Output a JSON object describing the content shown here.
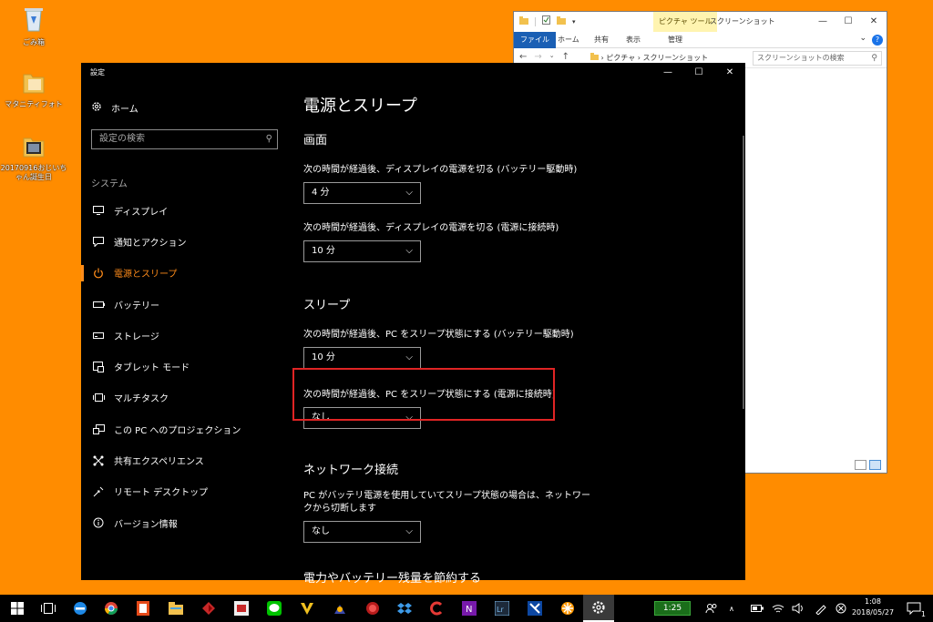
{
  "desktop": {
    "icons": [
      {
        "label": "ごみ箱"
      },
      {
        "label": "マタニティフォト"
      },
      {
        "label": "20170916おじいちゃん誕生日"
      }
    ]
  },
  "explorer": {
    "context_tab": "ピクチャ ツール",
    "title": "スクリーンショット",
    "tabs": [
      "ファイル",
      "ホーム",
      "共有",
      "表示",
      "管理"
    ],
    "path": "› ピクチャ › スクリーンショット",
    "search_placeholder": "スクリーンショットの検索",
    "help": "?"
  },
  "settings": {
    "window_title": "設定",
    "home_label": "ホーム",
    "search_placeholder": "設定の検索",
    "section_label": "システム",
    "nav_items": [
      {
        "label": "ディスプレイ",
        "icon": "display-icon"
      },
      {
        "label": "通知とアクション",
        "icon": "notification-icon"
      },
      {
        "label": "電源とスリープ",
        "icon": "power-icon",
        "active": true
      },
      {
        "label": "バッテリー",
        "icon": "battery-icon"
      },
      {
        "label": "ストレージ",
        "icon": "storage-icon"
      },
      {
        "label": "タブレット モード",
        "icon": "tablet-icon"
      },
      {
        "label": "マルチタスク",
        "icon": "multitask-icon"
      },
      {
        "label": "この PC へのプロジェクション",
        "icon": "projection-icon"
      },
      {
        "label": "共有エクスペリエンス",
        "icon": "shared-icon"
      },
      {
        "label": "リモート デスクトップ",
        "icon": "remote-icon"
      },
      {
        "label": "バージョン情報",
        "icon": "info-icon"
      }
    ],
    "page_title": "電源とスリープ",
    "screen": {
      "heading": "画面",
      "battery_label": "次の時間が経過後、ディスプレイの電源を切る (バッテリー駆動時)",
      "battery_value": "4 分",
      "plugged_label": "次の時間が経過後、ディスプレイの電源を切る (電源に接続時)",
      "plugged_value": "10 分"
    },
    "sleep": {
      "heading": "スリープ",
      "battery_label": "次の時間が経過後、PC をスリープ状態にする (バッテリー駆動時)",
      "battery_value": "10 分",
      "plugged_label": "次の時間が経過後、PC をスリープ状態にする (電源に接続時)",
      "plugged_value": "なし"
    },
    "network": {
      "heading": "ネットワーク接続",
      "label": "PC がバッテリ電源を使用していてスリープ状態の場合は、ネットワークから切断します",
      "value": "なし"
    },
    "saving": {
      "heading": "電力やバッテリー残量を節約する"
    }
  },
  "taskbar": {
    "battery_time": "1:25",
    "time": "1:08",
    "date": "2018/05/27",
    "notification_count": "1"
  },
  "colors": {
    "desktop": "#ff8c00",
    "accent": "#ff8c1a",
    "highlight_border": "#e02424"
  }
}
